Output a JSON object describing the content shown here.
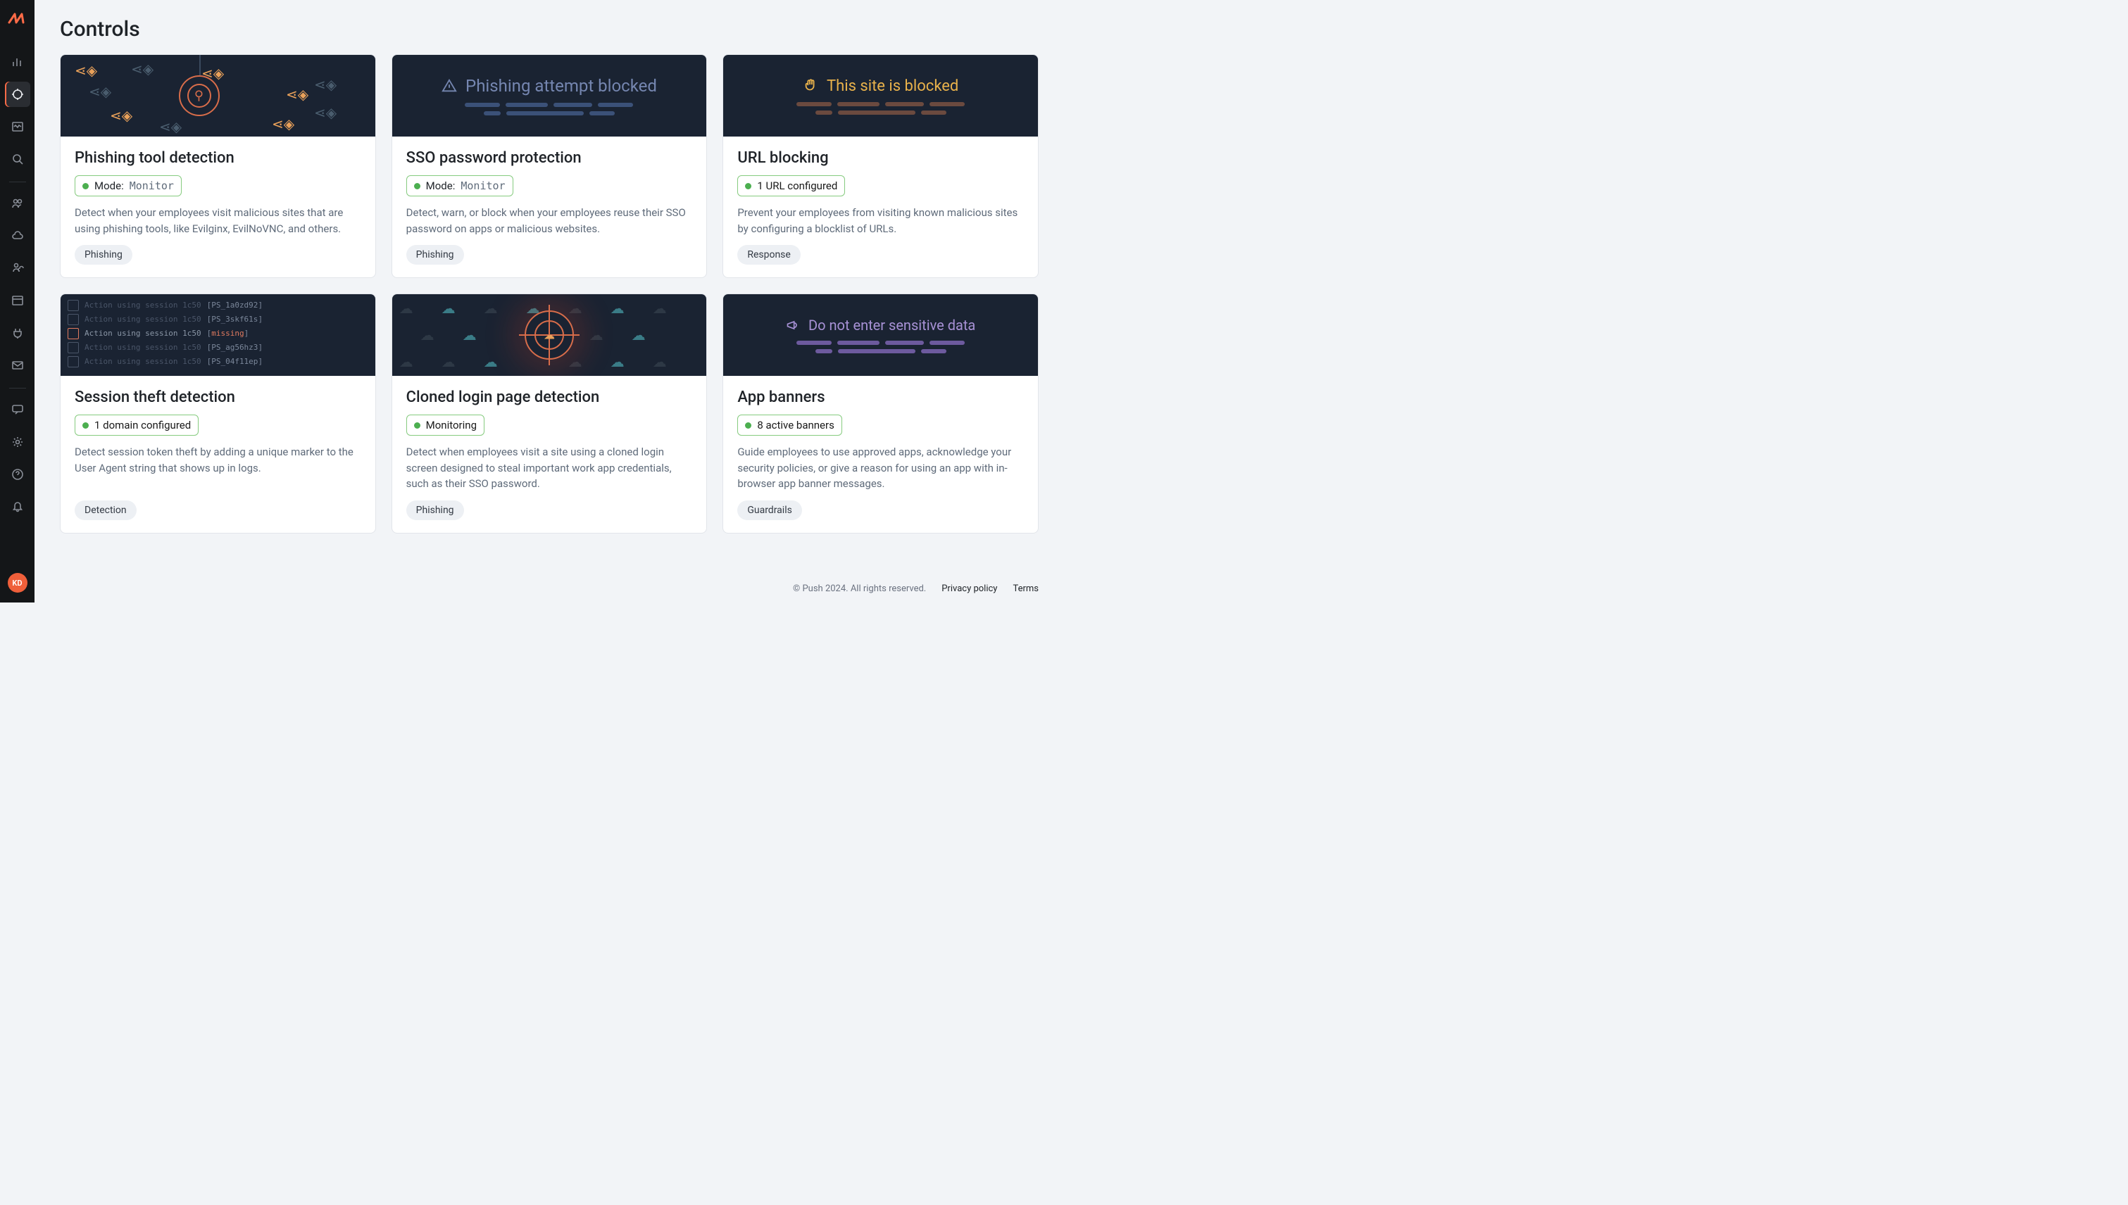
{
  "page": {
    "title": "Controls"
  },
  "sidebar": {
    "avatar_initials": "KD"
  },
  "cards": [
    {
      "title": "Phishing tool detection",
      "status_prefix": "Mode:",
      "status_value": "Monitor",
      "desc": "Detect when your employees visit malicious sites that are using phishing tools, like Evilginx, EvilNoVNC, and others.",
      "tag": "Phishing"
    },
    {
      "title": "SSO password protection",
      "hero_text": "Phishing attempt blocked",
      "status_prefix": "Mode:",
      "status_value": "Monitor",
      "desc": "Detect, warn, or block when your employees reuse their SSO password on apps or malicious websites.",
      "tag": "Phishing"
    },
    {
      "title": "URL blocking",
      "hero_text": "This site is blocked",
      "status_value": "1 URL configured",
      "desc": "Prevent your employees from visiting known malicious sites by configuring a blocklist of URLs.",
      "tag": "Response"
    },
    {
      "title": "Session theft detection",
      "status_value": "1 domain configured",
      "desc": "Detect session token theft by adding a unique marker to the User Agent string that shows up in logs.",
      "tag": "Detection",
      "hero_logs": {
        "line_text": "Action using session 1c50",
        "codes": [
          "PS_1a0zd92",
          "PS_3skf61s",
          "missing",
          "PS_ag56hz3",
          "PS_04f11ep"
        ]
      }
    },
    {
      "title": "Cloned login page detection",
      "status_value": "Monitoring",
      "desc": "Detect when employees visit a site using a cloned login screen designed to steal important work app credentials, such as their SSO password.",
      "tag": "Phishing"
    },
    {
      "title": "App banners",
      "hero_text": "Do not enter sensitive data",
      "status_value": "8 active banners",
      "desc": "Guide employees to use approved apps, acknowledge your security policies, or give a reason for using an app with in-browser app banner messages.",
      "tag": "Guardrails"
    }
  ],
  "footer": {
    "copyright": "© Push 2024. All rights reserved.",
    "privacy": "Privacy policy",
    "terms": "Terms"
  }
}
